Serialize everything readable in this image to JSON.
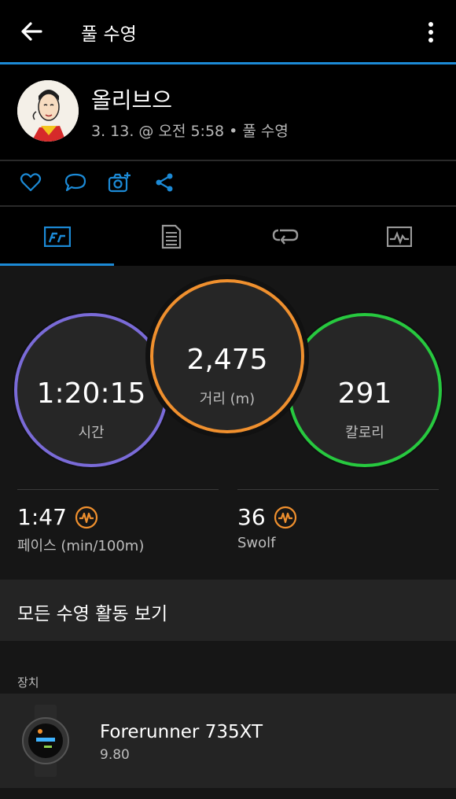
{
  "header": {
    "title": "풀 수영",
    "back_icon": "arrow-left-icon",
    "more_icon": "more-vert-icon"
  },
  "profile": {
    "name": "올리브으",
    "meta": "3. 13. @ 오전 5:58 • 풀 수영"
  },
  "actions": [
    "heart-icon",
    "comment-icon",
    "camera-add-icon",
    "share-icon"
  ],
  "tabs": [
    {
      "icon": "stats-icon",
      "active": true
    },
    {
      "icon": "details-icon",
      "active": false
    },
    {
      "icon": "laps-icon",
      "active": false
    },
    {
      "icon": "chart-icon",
      "active": false
    }
  ],
  "circles": {
    "time": {
      "value": "1:20:15",
      "label": "시간"
    },
    "distance": {
      "value": "2,475",
      "label": "거리 (m)"
    },
    "calories": {
      "value": "291",
      "label": "칼로리"
    }
  },
  "metrics": {
    "pace": {
      "value": "1:47",
      "label": "페이스 (min/100m)"
    },
    "swolf": {
      "value": "36",
      "label": "Swolf"
    }
  },
  "view_all": "모든 수영 활동 보기",
  "device_section_label": "장치",
  "device": {
    "name": "Forerunner 735XT",
    "version": "9.80"
  },
  "colors": {
    "accent": "#1c8ad6",
    "time": "#7a6bd8",
    "distance": "#f0902e",
    "calories": "#27c93f"
  }
}
